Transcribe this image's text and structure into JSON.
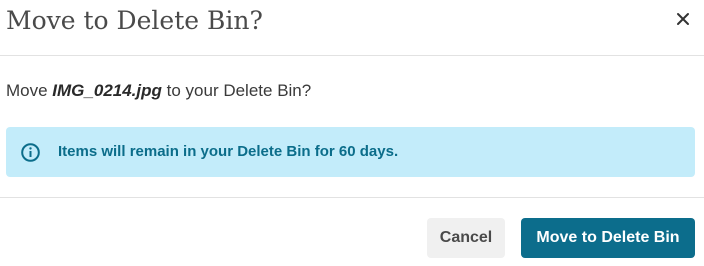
{
  "dialog": {
    "title": "Move to Delete Bin?",
    "close_icon": "close-icon",
    "message": {
      "prefix": "Move ",
      "filename": "IMG_0214.jpg",
      "suffix": " to your Delete Bin?"
    },
    "info": {
      "icon": "info-icon",
      "text": "Items will remain in your Delete Bin for 60 days."
    },
    "buttons": {
      "cancel_label": "Cancel",
      "confirm_label": "Move to Delete Bin"
    }
  },
  "colors": {
    "info_background": "#c3ecfa",
    "info_text": "#0b6d8a",
    "primary_button": "#0c6d8c",
    "secondary_button": "#f0f0f0"
  }
}
